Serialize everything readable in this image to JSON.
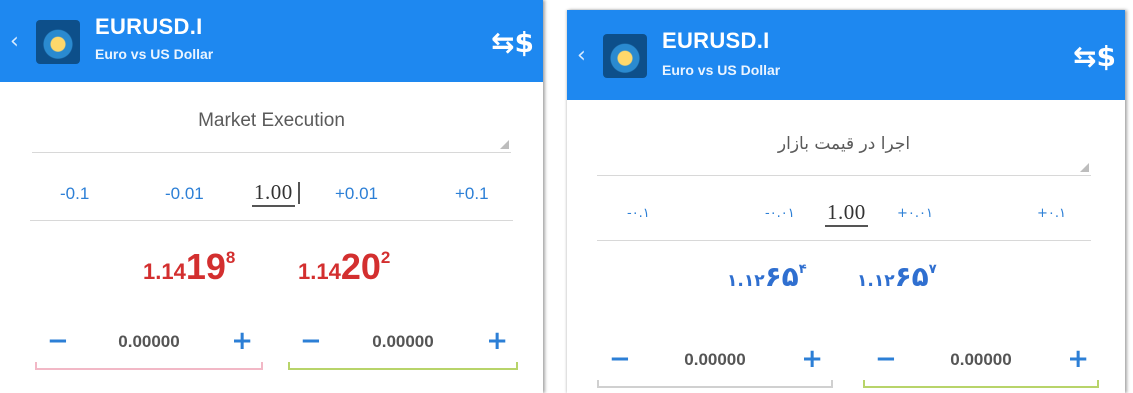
{
  "left": {
    "header": {
      "symbol": "EURUSD.I",
      "description": "Euro vs US Dollar"
    },
    "execution_type": "Market Execution",
    "volume": {
      "buttons": [
        "-0.1",
        "-0.01",
        "+0.01",
        "+0.1"
      ],
      "value": "1.00"
    },
    "bid": {
      "prefix": "1.14",
      "big": "19",
      "sup": "8"
    },
    "ask": {
      "prefix": "1.14",
      "big": "20",
      "sup": "2"
    },
    "stop_loss": {
      "value": "0.00000",
      "minus": "−",
      "plus": "+"
    },
    "take_profit": {
      "value": "0.00000",
      "minus": "−",
      "plus": "+"
    }
  },
  "right": {
    "header": {
      "symbol": "EURUSD.I",
      "description": "Euro vs US Dollar"
    },
    "execution_type": "اجرا در قیمت بازار",
    "volume": {
      "buttons": [
        "-۰.۱",
        "-۰.۰۱",
        "+۰.۰۱",
        "+۰.۱"
      ],
      "value": "1.00"
    },
    "bid": {
      "prefix": "۱.۱۲",
      "big": "۶۵",
      "sup": "۴"
    },
    "ask": {
      "prefix": "۱.۱۲",
      "big": "۶۵",
      "sup": "۷"
    },
    "stop_loss": {
      "value": "0.00000",
      "minus": "−",
      "plus": "+"
    },
    "take_profit": {
      "value": "0.00000",
      "minus": "−",
      "plus": "+"
    }
  },
  "icons": {
    "back": "‹",
    "trade": "⇆$"
  },
  "colors": {
    "header_blue": "#1e88f0",
    "price_red": "#d32f2f",
    "price_blue": "#2f6fd0",
    "button_blue": "#2c7fd6",
    "sl_accent": "#f2b8c6",
    "tp_accent": "#b8d46a"
  }
}
